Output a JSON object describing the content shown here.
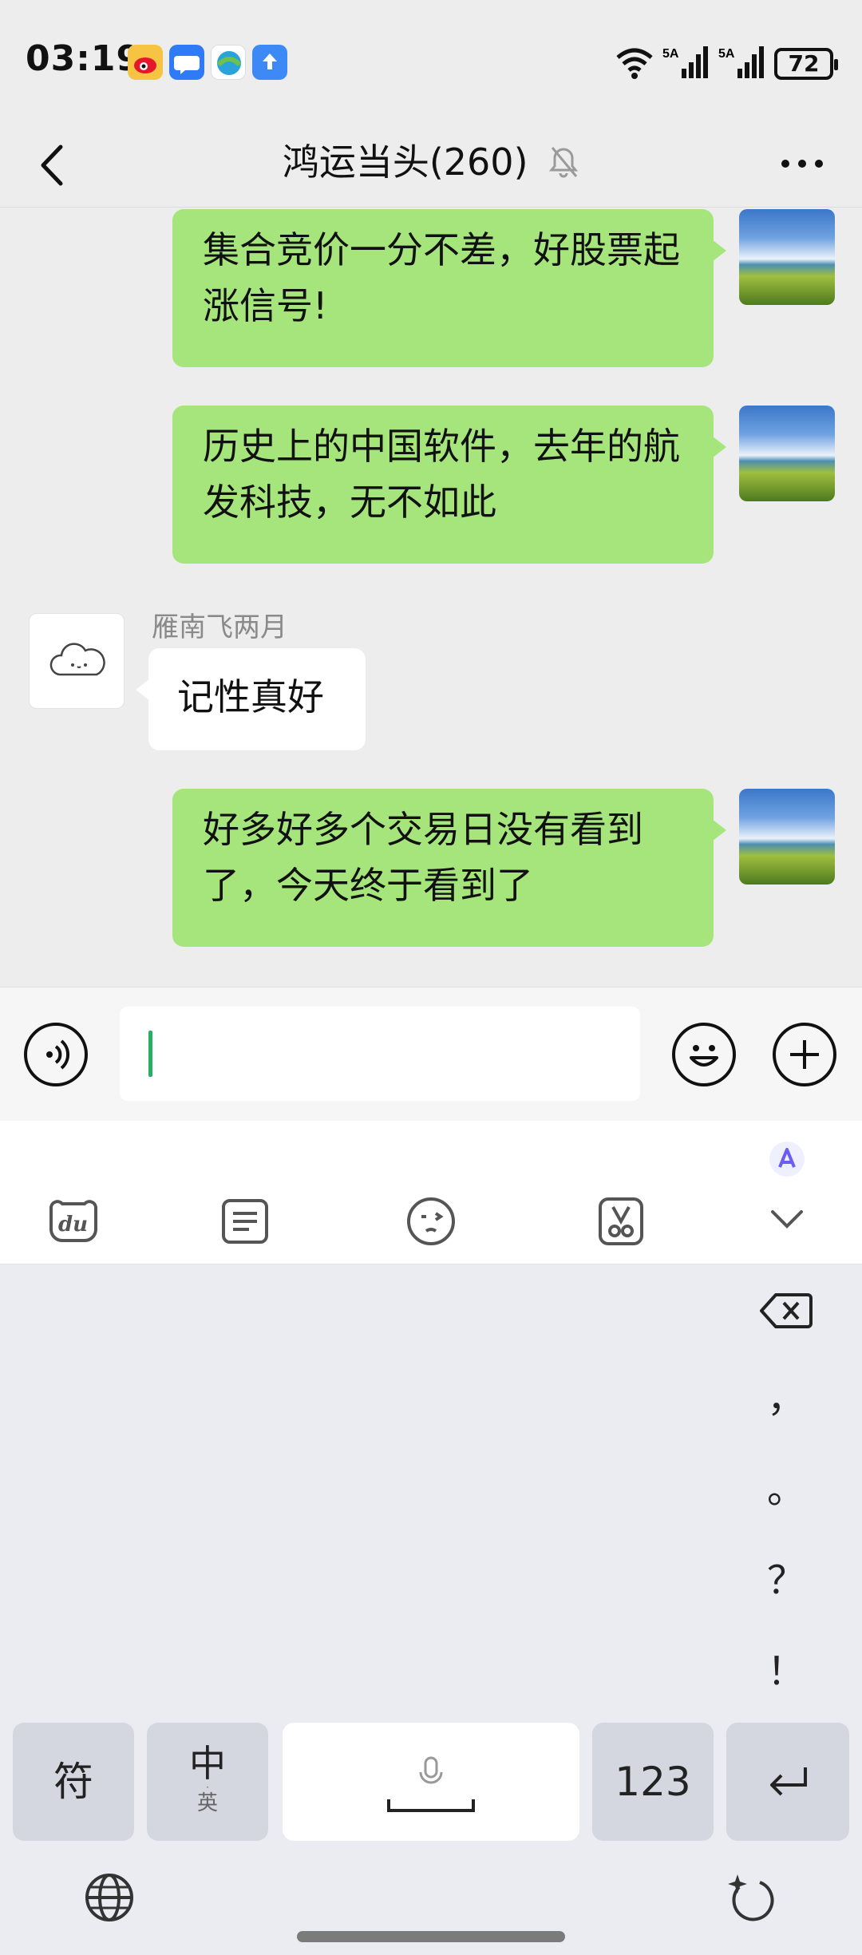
{
  "status_bar": {
    "time": "03:19",
    "battery": "72",
    "app_icons": [
      "weibo-icon",
      "message-icon",
      "browser-icon",
      "upload-icon"
    ],
    "signal_icons": [
      "wifi-icon",
      "signal-5a-icon",
      "signal-5a-icon"
    ]
  },
  "header": {
    "title": "鸿运当头(260)",
    "muted_icon": "bell-off-icon"
  },
  "messages": [
    {
      "side": "me",
      "text": "集合竞价一分不差，好股票起涨信号!"
    },
    {
      "side": "me",
      "text": "历史上的中国软件，去年的航发科技，无不如此"
    },
    {
      "side": "other",
      "sender": "雁南飞两月",
      "text": "记性真好"
    },
    {
      "side": "me",
      "text": "好多好多个交易日没有看到了，今天终于看到了"
    }
  ],
  "input": {
    "value": ""
  },
  "keyboard": {
    "toolbar_icons": [
      "du-logo-icon",
      "clipboard-icon",
      "emoji-icon",
      "scissors-icon",
      "chevron-down-icon"
    ],
    "punctuation": [
      "，",
      "。",
      "？",
      "！"
    ],
    "keys": {
      "symbols": "符",
      "lang_main": "中",
      "lang_sub": "英",
      "numbers": "123"
    }
  },
  "colors": {
    "my_bubble": "#a5e57b",
    "other_bubble": "#ffffff",
    "background": "#ededed",
    "caret": "#2aae67"
  }
}
